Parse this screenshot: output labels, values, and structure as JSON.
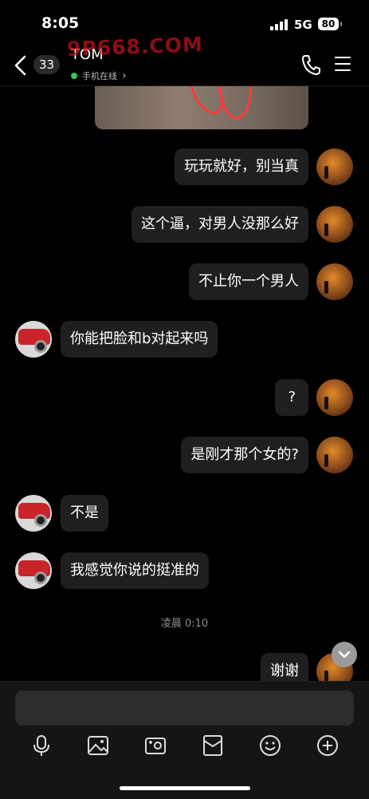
{
  "status_bar": {
    "time": "8:05",
    "network": "5G",
    "battery": "80"
  },
  "header": {
    "unread_count": "33",
    "contact_name": "TOM",
    "online_status": "手机在线",
    "online_arrow": "›"
  },
  "watermark": {
    "text": "9P668.COM"
  },
  "messages": [
    {
      "sender": "me",
      "text": "玩玩就好，别当真"
    },
    {
      "sender": "me",
      "text": "这个逼，对男人没那么好"
    },
    {
      "sender": "me",
      "text": "不止你一个男人"
    },
    {
      "sender": "them",
      "text": "你能把脸和b对起来吗"
    },
    {
      "sender": "me",
      "text": "?"
    },
    {
      "sender": "me",
      "text": "是刚才那个女的?"
    },
    {
      "sender": "them",
      "text": "不是"
    },
    {
      "sender": "them",
      "text": "我感觉你说的挺准的"
    },
    {
      "sender": "me",
      "text": "谢谢"
    }
  ],
  "timestamp": "凌晨 0:10",
  "icons": {
    "back": "chevron-left-icon",
    "call": "phone-icon",
    "menu": "menu-icon",
    "toolbar": [
      "microphone-icon",
      "image-icon",
      "camera-icon",
      "red-packet-icon",
      "emoji-icon",
      "plus-icon"
    ],
    "scroll": "chevron-down-icon"
  },
  "colors": {
    "online": "#34c759",
    "bubble": "#1f1f21",
    "watermark": "#c9141a"
  }
}
